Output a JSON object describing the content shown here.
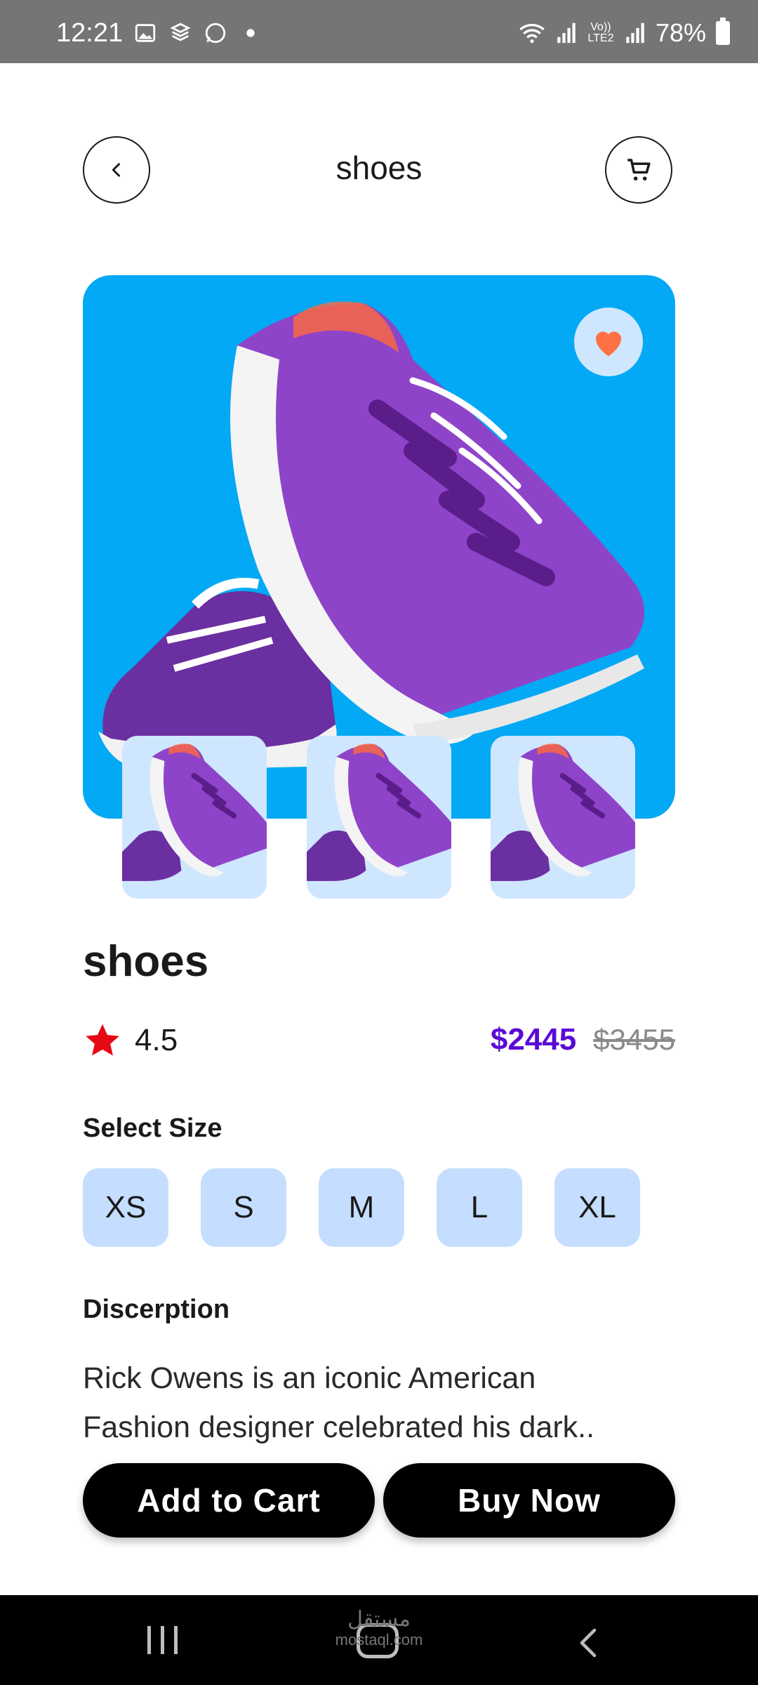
{
  "status_bar": {
    "time": "12:21",
    "battery": "78%",
    "network_label": "Vo)) LTE2"
  },
  "header": {
    "title": "shoes",
    "back_icon": "chevron-left-icon",
    "cart_icon": "shopping-cart-icon"
  },
  "product": {
    "name": "shoes",
    "rating": "4.5",
    "price": "$2445",
    "old_price": "$3455",
    "favorite_icon": "heart-icon",
    "accent_color": "#03a9f4",
    "heart_color": "#ff7043"
  },
  "size_section": {
    "label": "Select Size",
    "sizes": [
      "XS",
      "S",
      "M",
      "L",
      "XL"
    ]
  },
  "description": {
    "label": "Discerption",
    "line1": "Rick Owens is an iconic American",
    "line2": "Fashion designer celebrated his dark.."
  },
  "actions": {
    "add_to_cart": "Add to Cart",
    "buy_now": "Buy Now"
  },
  "watermark": {
    "arabic": "مستقل",
    "domain": "mostaql.com"
  }
}
